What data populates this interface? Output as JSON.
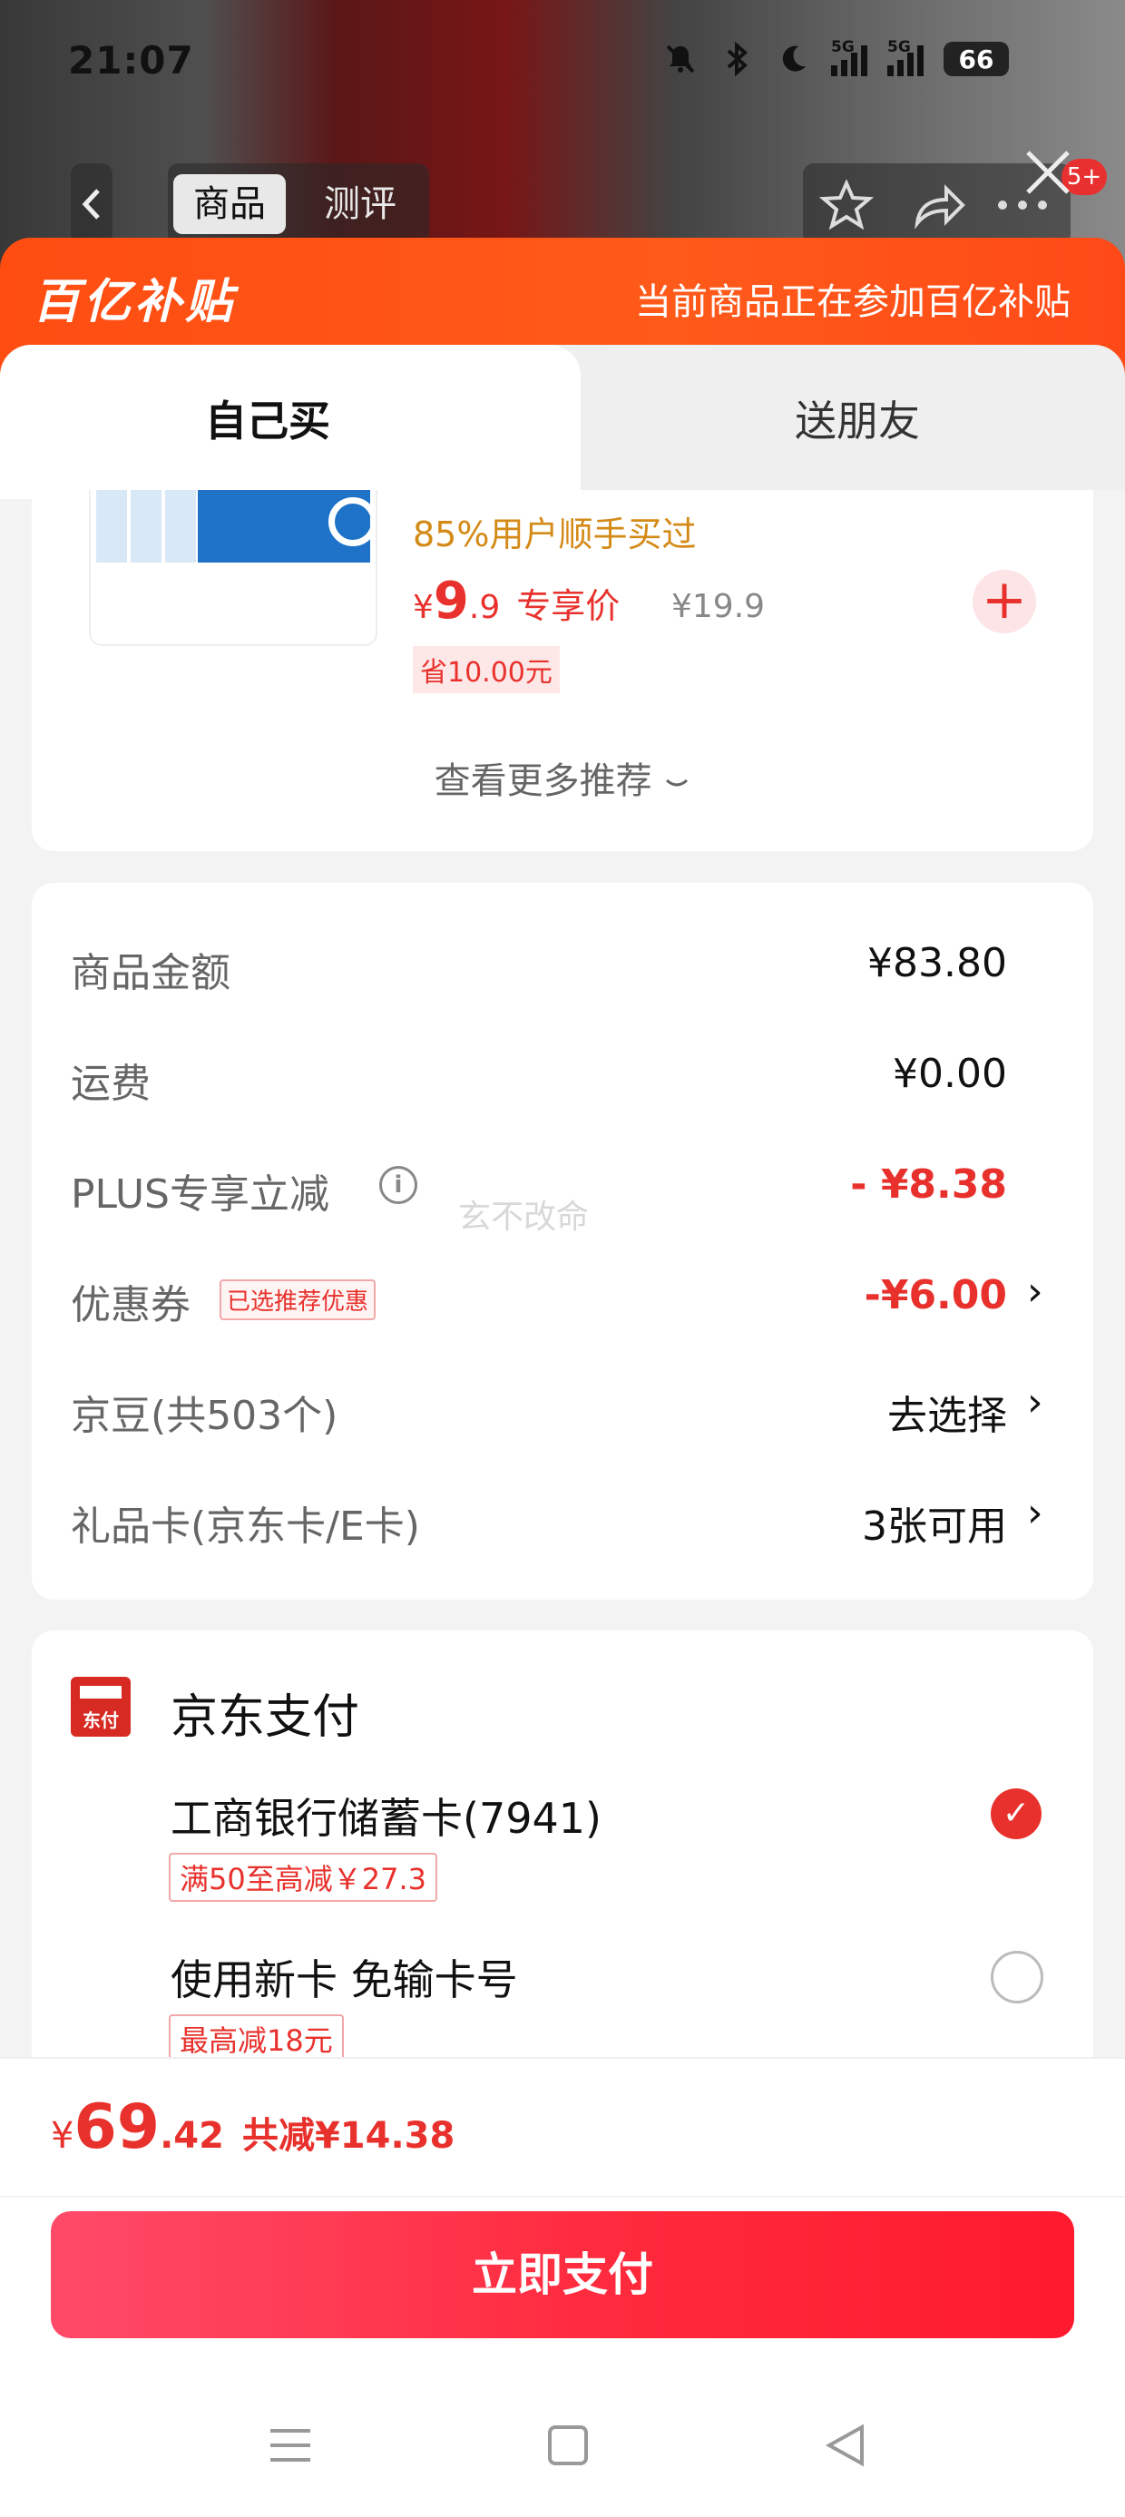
{
  "status_bar": {
    "time": "21:07",
    "signal1": "5G",
    "signal2": "5G",
    "battery": "66"
  },
  "header": {
    "tab_goods": "商品",
    "tab_review": "测评",
    "badge": "5+"
  },
  "banner": {
    "logo": "百亿补贴",
    "text": "当前商品正在参加百亿补贴"
  },
  "buy_tabs": {
    "self": "自己买",
    "friend": "送朋友"
  },
  "recommend": {
    "buy_rate": "85%用户顺手买过",
    "price_symbol": "¥",
    "price_int": "9",
    "price_dec": ".9",
    "price_tag": "专享价",
    "original_price": "¥19.9",
    "save": "省10.00元",
    "add": "+",
    "more": "查看更多推荐"
  },
  "summary": {
    "goods_label": "商品金额",
    "goods_value": "¥83.80",
    "shipping_label": "运费",
    "shipping_value": "¥0.00",
    "plus_label": "PLUS专享立减",
    "plus_value": "- ¥8.38",
    "coupon_label": "优惠券",
    "coupon_tag": "已选推荐优惠",
    "coupon_value": "-¥6.00",
    "jingdou_label": "京豆(共503个)",
    "jingdou_value": "去选择",
    "giftcard_label": "礼品卡(京东卡/E卡)",
    "giftcard_value": "3张可用",
    "watermark": "玄不改命"
  },
  "payment": {
    "logo_text": "东付",
    "title": "京东支付",
    "card1": "工商银行储蓄卡(7941)",
    "card1_tag": "满50至高减￥27.3",
    "card2": "使用新卡 免输卡号",
    "card2_tag": "最高减18元"
  },
  "bottom": {
    "total_symbol": "¥",
    "total_int": "69",
    "total_dec": ".42",
    "total_save": "共减¥14.38",
    "pay_button": "立即支付"
  },
  "colors": {
    "accent": "#e8312c",
    "banner": "#ff5a1a",
    "pay_button": "#ff2a3d"
  }
}
